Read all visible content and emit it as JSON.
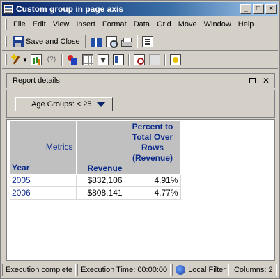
{
  "window": {
    "title": "Custom group in page axis"
  },
  "menu": {
    "items": [
      "File",
      "Edit",
      "View",
      "Insert",
      "Format",
      "Data",
      "Grid",
      "Move",
      "Window",
      "Help"
    ]
  },
  "toolbar": {
    "save_close_label": "Save and Close",
    "parens_glyph": "(?)"
  },
  "report_details": {
    "label": "Report details"
  },
  "page_by": {
    "selected": "Age Groups: < 25"
  },
  "grid": {
    "metrics_label": "Metrics",
    "row_header": "Year",
    "columns": [
      "Revenue",
      "Percent to Total Over Rows (Revenue)"
    ],
    "pct_lines": [
      "Percent to",
      "Total Over",
      "Rows",
      "(Revenue)"
    ],
    "rows": [
      {
        "year": "2005",
        "revenue": "$832,106",
        "pct": "4.91%"
      },
      {
        "year": "2006",
        "revenue": "$808,141",
        "pct": "4.77%"
      }
    ]
  },
  "status": {
    "execution": "Execution complete",
    "time": "Execution Time: 00:00:00",
    "filter": "Local Filter",
    "columns": "Columns: 2"
  },
  "colors": {
    "title_start": "#0a246a",
    "title_end": "#a6caf0",
    "header_text": "#0a2a8a",
    "header_bg": "#c0c0c0"
  },
  "icons": [
    "app-icon",
    "minimize-icon",
    "maximize-icon",
    "close-icon",
    "floppy-icon",
    "book-icon",
    "print-preview-icon",
    "printer-icon",
    "properties-icon",
    "wand-icon",
    "chart-icon",
    "shapes-icon",
    "grid-icon",
    "filter-icon",
    "panel-icon",
    "find-icon",
    "wizard-icon",
    "globe-icon"
  ]
}
